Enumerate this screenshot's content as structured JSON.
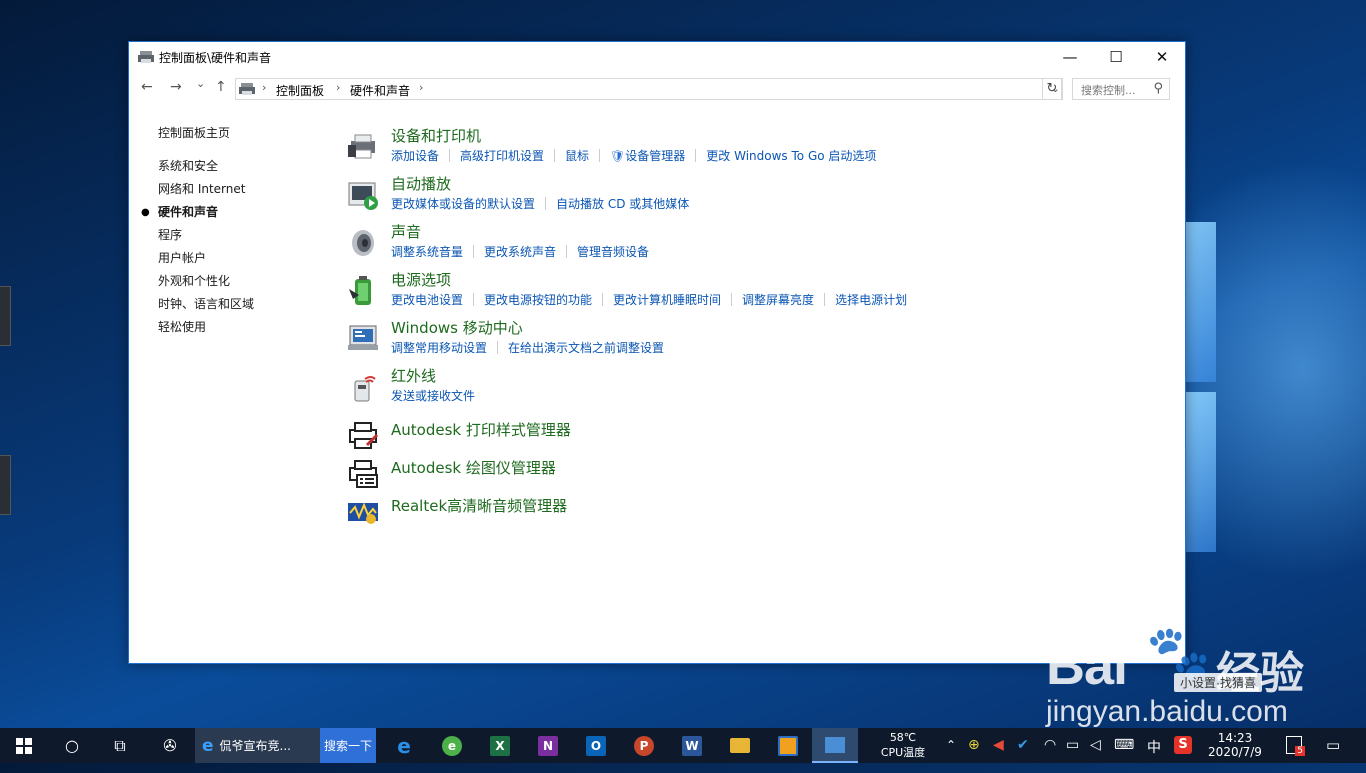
{
  "window": {
    "title": "控制面板\\硬件和声音",
    "minimize": "—",
    "maximize": "☐",
    "close": "✕"
  },
  "nav": {
    "back": "←",
    "forward": "→",
    "recent": "⌄",
    "up": "↑",
    "breadcrumb": [
      "控制面板",
      "硬件和声音"
    ],
    "search_placeholder": "搜索控制...",
    "refresh": "↻"
  },
  "sidebar": {
    "home": "控制面板主页",
    "items": [
      {
        "label": "系统和安全",
        "active": false
      },
      {
        "label": "网络和 Internet",
        "active": false
      },
      {
        "label": "硬件和声音",
        "active": true
      },
      {
        "label": "程序",
        "active": false
      },
      {
        "label": "用户帐户",
        "active": false
      },
      {
        "label": "外观和个性化",
        "active": false
      },
      {
        "label": "时钟、语言和区域",
        "active": false
      },
      {
        "label": "轻松使用",
        "active": false
      }
    ]
  },
  "categories": [
    {
      "title": "设备和打印机",
      "icon": "printer-device-icon",
      "links": [
        "添加设备",
        "高级打印机设置",
        "鼠标",
        "设备管理器",
        "更改 Windows To Go 启动选项"
      ]
    },
    {
      "title": "自动播放",
      "icon": "autoplay-icon",
      "links": [
        "更改媒体或设备的默认设置",
        "自动播放 CD 或其他媒体"
      ]
    },
    {
      "title": "声音",
      "icon": "speaker-icon",
      "links": [
        "调整系统音量",
        "更改系统声音",
        "管理音频设备"
      ]
    },
    {
      "title": "电源选项",
      "icon": "battery-icon",
      "links": [
        "更改电池设置",
        "更改电源按钮的功能",
        "更改计算机睡眠时间",
        "调整屏幕亮度",
        "选择电源计划"
      ]
    },
    {
      "title": "Windows 移动中心",
      "icon": "mobility-center-icon",
      "links": [
        "调整常用移动设置",
        "在给出演示文档之前调整设置"
      ]
    },
    {
      "title": "红外线",
      "icon": "infrared-icon",
      "links": [
        "发送或接收文件"
      ]
    },
    {
      "title": "Autodesk 打印样式管理器",
      "icon": "print-style-icon",
      "links": []
    },
    {
      "title": "Autodesk 绘图仪管理器",
      "icon": "plotter-icon",
      "links": []
    },
    {
      "title": "Realtek高清晰音频管理器",
      "icon": "realtek-audio-icon",
      "links": []
    }
  ],
  "taskbar": {
    "browser_tab": "侃爷宣布竞...",
    "search_button": "搜索一下",
    "cpu_temp": "58℃",
    "cpu_label": "CPU温度",
    "ime": "中",
    "time": "14:23",
    "date": "2020/7/9",
    "notif_badge": "5"
  },
  "watermark": {
    "brand": "Bai",
    "brand2": "经验",
    "url": "jingyan.baidu.com",
    "overlay": "小设置·找猜喜"
  }
}
